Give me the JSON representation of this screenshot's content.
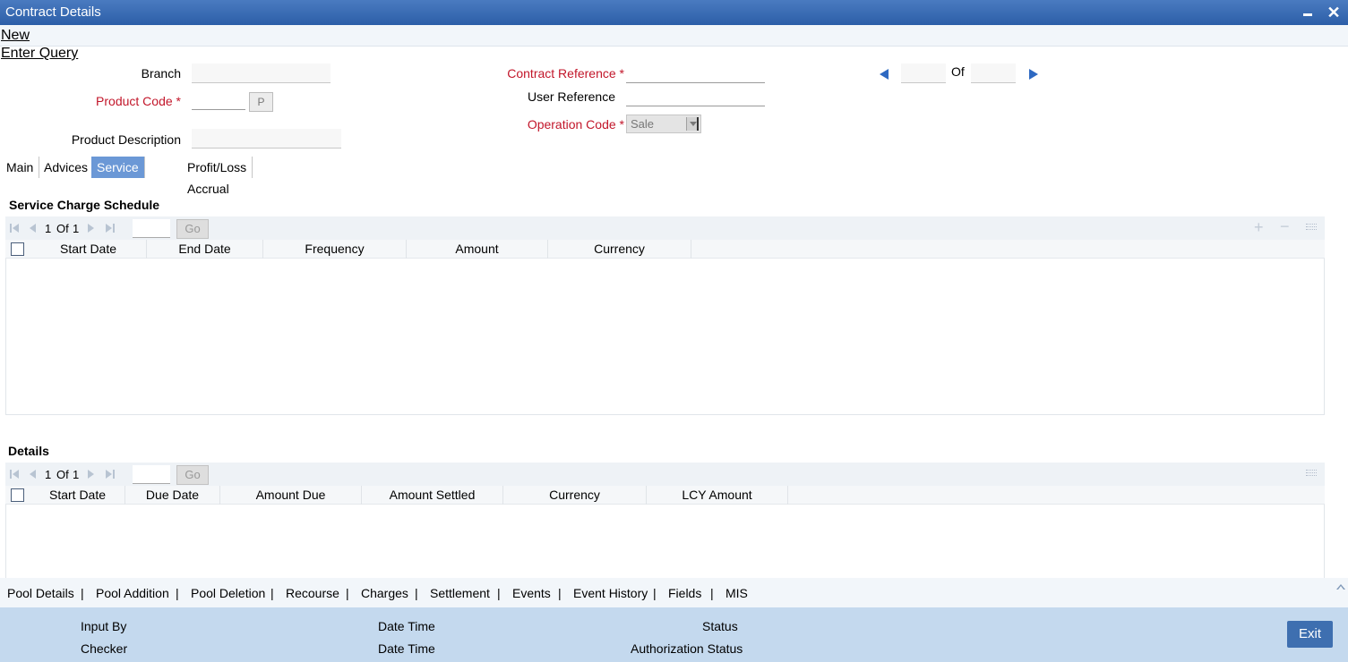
{
  "window": {
    "title": "Contract Details"
  },
  "menu": {
    "new": "New",
    "enter_query": "Enter Query"
  },
  "form": {
    "branch_label": "Branch",
    "product_code_label": "Product Code",
    "product_code_button": "P",
    "product_description_label": "Product Description",
    "contract_reference_label": "Contract Reference",
    "user_reference_label": "User Reference",
    "operation_code_label": "Operation Code",
    "operation_code_value": "Sale",
    "required_marker": "*",
    "of_label": "Of"
  },
  "tabs": [
    {
      "label": "Main"
    },
    {
      "label": "Advices"
    },
    {
      "label": "Service Charge"
    },
    {
      "label": "Profit/Loss Accrual"
    }
  ],
  "service_charge_schedule": {
    "title": "Service Charge Schedule",
    "pager": {
      "current": "1",
      "of_label": "Of",
      "total": "1",
      "go": "Go"
    },
    "columns": [
      "Start Date",
      "End Date",
      "Frequency",
      "Amount",
      "Currency"
    ]
  },
  "details": {
    "title": "Details",
    "pager": {
      "current": "1",
      "of_label": "Of",
      "total": "1",
      "go": "Go"
    },
    "columns": [
      "Start Date",
      "Due Date",
      "Amount Due",
      "Amount Settled",
      "Currency",
      "LCY Amount"
    ]
  },
  "footer_links": [
    "Pool Details",
    "Pool Addition",
    "Pool Deletion",
    "Recourse",
    "Charges",
    "Settlement",
    "Events",
    "Event History",
    "Fields",
    "MIS"
  ],
  "footer_separator": "|",
  "audit": {
    "input_by": "Input By",
    "checker": "Checker",
    "date_time_1": "Date Time",
    "date_time_2": "Date Time",
    "status": "Status",
    "authorization_status": "Authorization Status",
    "exit": "Exit"
  }
}
